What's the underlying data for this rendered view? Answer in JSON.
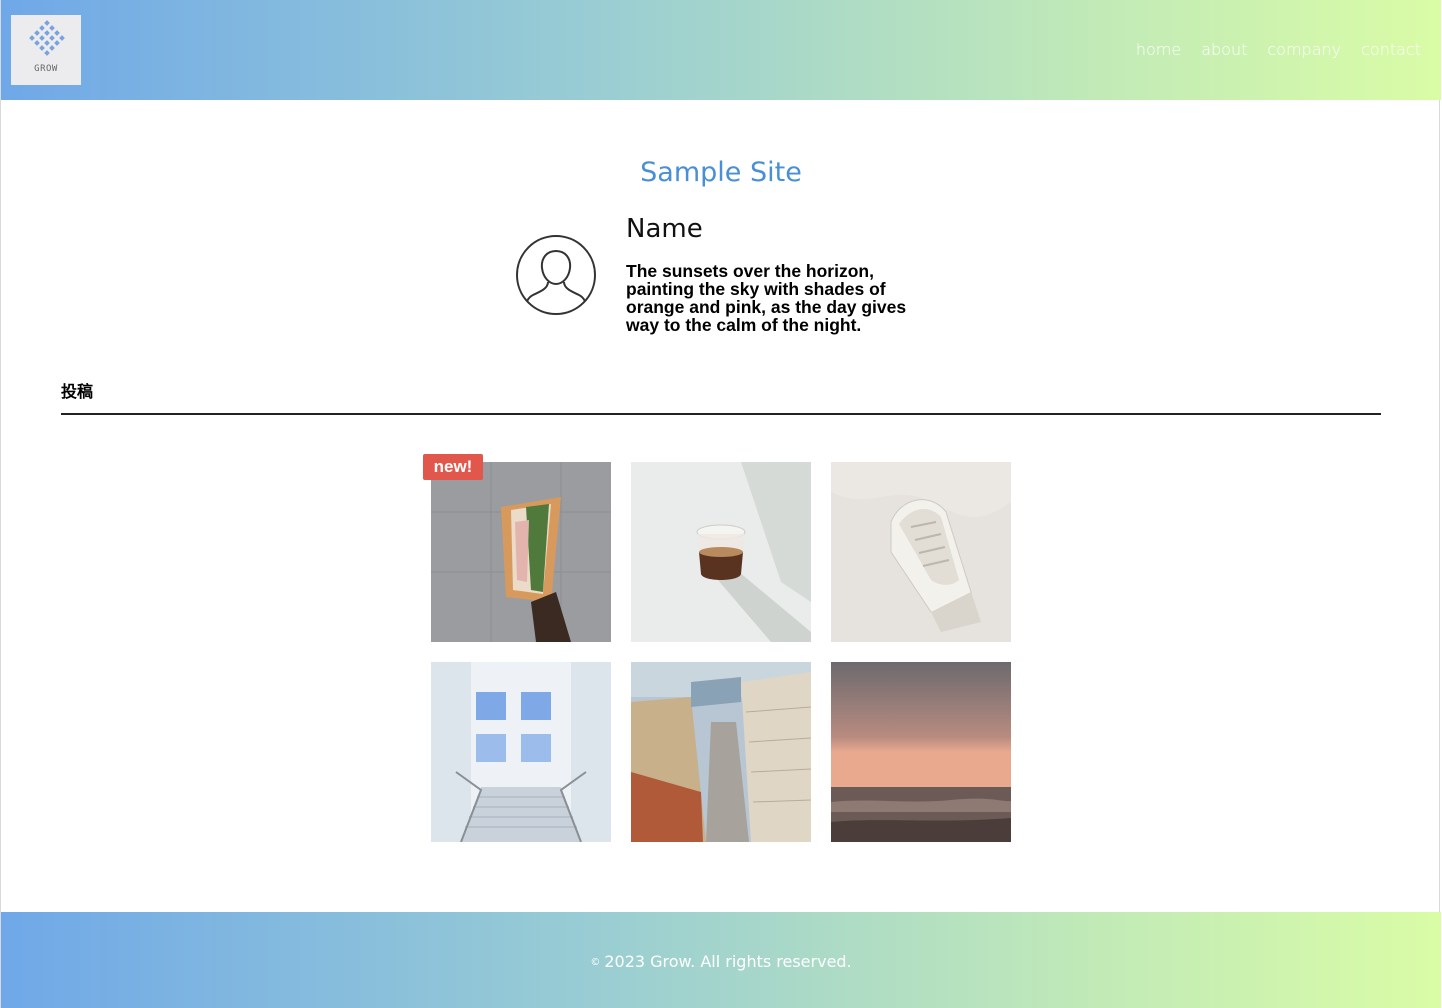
{
  "header": {
    "logo_text": "GROW",
    "nav": [
      "home",
      "about",
      "company",
      "contact"
    ]
  },
  "main": {
    "site_title": "Sample Site",
    "profile": {
      "name": "Name",
      "bio": "The sunsets over the horizon, painting the sky with shades of orange and pink, as the day gives way to the calm of the night."
    },
    "section_heading": "投稿",
    "badge": "new!",
    "posts": [
      "sandwich-photo",
      "coffee-glass-photo",
      "sneaker-photo",
      "staircase-photo",
      "city-street-photo",
      "sunset-beach-photo"
    ]
  },
  "footer": {
    "symbol": "©",
    "copyright": "2023 Grow. All rights reserved."
  },
  "colors": {
    "gradient_start": "#6fa8e8",
    "gradient_end": "#dafca6",
    "title": "#4a8fd4",
    "badge": "#e2574c"
  }
}
